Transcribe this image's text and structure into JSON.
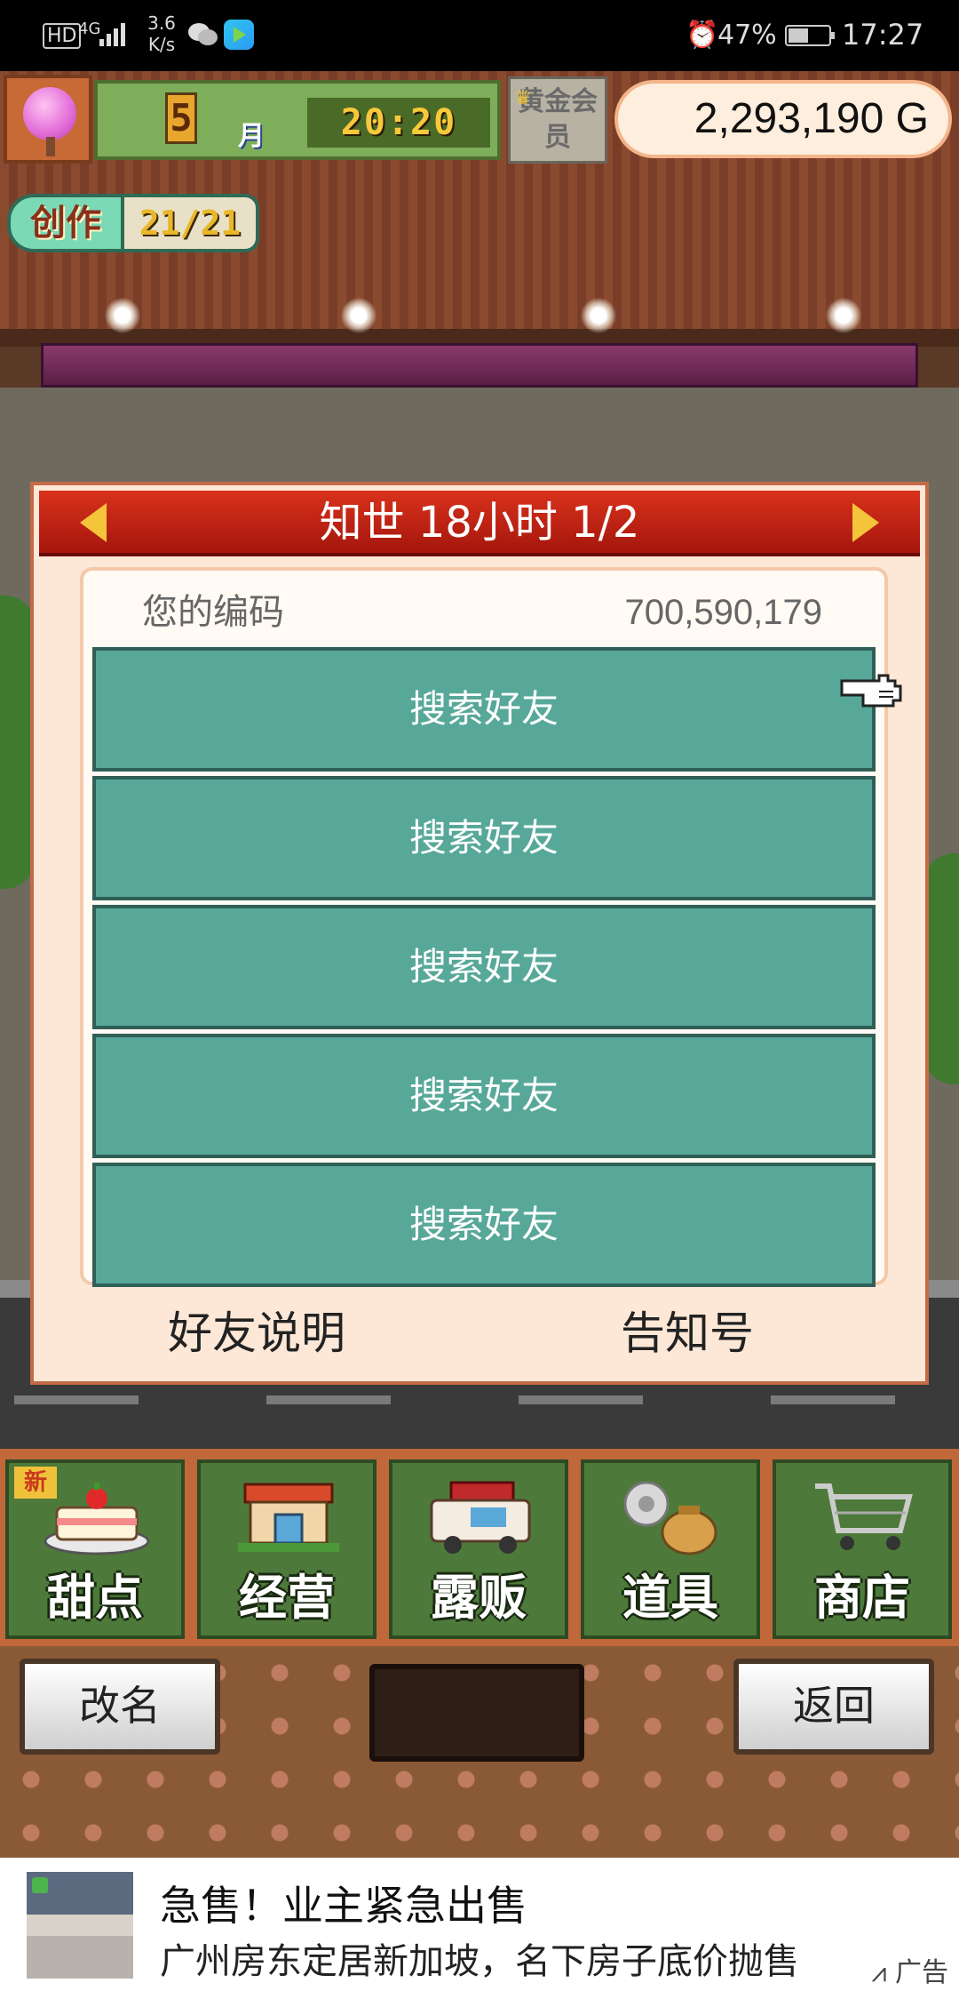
{
  "status_bar": {
    "hd": "HD",
    "signal": "4G",
    "speed_value": "3.6",
    "speed_unit": "K/s",
    "battery": "47%",
    "time": "17:27"
  },
  "hud": {
    "month": "5",
    "month_unit": "月",
    "clock": "20:20",
    "gold_member": "黄金会员",
    "money": "2,293,190 G",
    "create_label": "创作",
    "create_value": "21/21"
  },
  "dialog": {
    "title": "知世  18小时 1/2",
    "code_label": "您的编码",
    "code_value": "700,590,179",
    "slots": [
      {
        "label": "搜索好友"
      },
      {
        "label": "搜索好友"
      },
      {
        "label": "搜索好友"
      },
      {
        "label": "搜索好友"
      },
      {
        "label": "搜索好友"
      }
    ],
    "footer_left": "好友说明",
    "footer_right": "告知号"
  },
  "menu": {
    "new_tag": "新",
    "items": [
      {
        "label": "甜点",
        "icon": "cake-icon"
      },
      {
        "label": "经营",
        "icon": "shop-icon"
      },
      {
        "label": "露贩",
        "icon": "food-truck-icon"
      },
      {
        "label": "道具",
        "icon": "item-bag-icon"
      },
      {
        "label": "商店",
        "icon": "shopping-cart-icon"
      }
    ]
  },
  "bottom_bar": {
    "rename": "改名",
    "back": "返回"
  },
  "ad": {
    "title": "急售！业主紧急出售",
    "desc": "广州房东定居新加坡，名下房子底价抛售",
    "tag": "广告"
  },
  "colors": {
    "slot_teal": "#57a898",
    "header_red": "#c8241a",
    "dialog_bg": "#fde7d6",
    "menu_green": "#4d7a3a"
  }
}
